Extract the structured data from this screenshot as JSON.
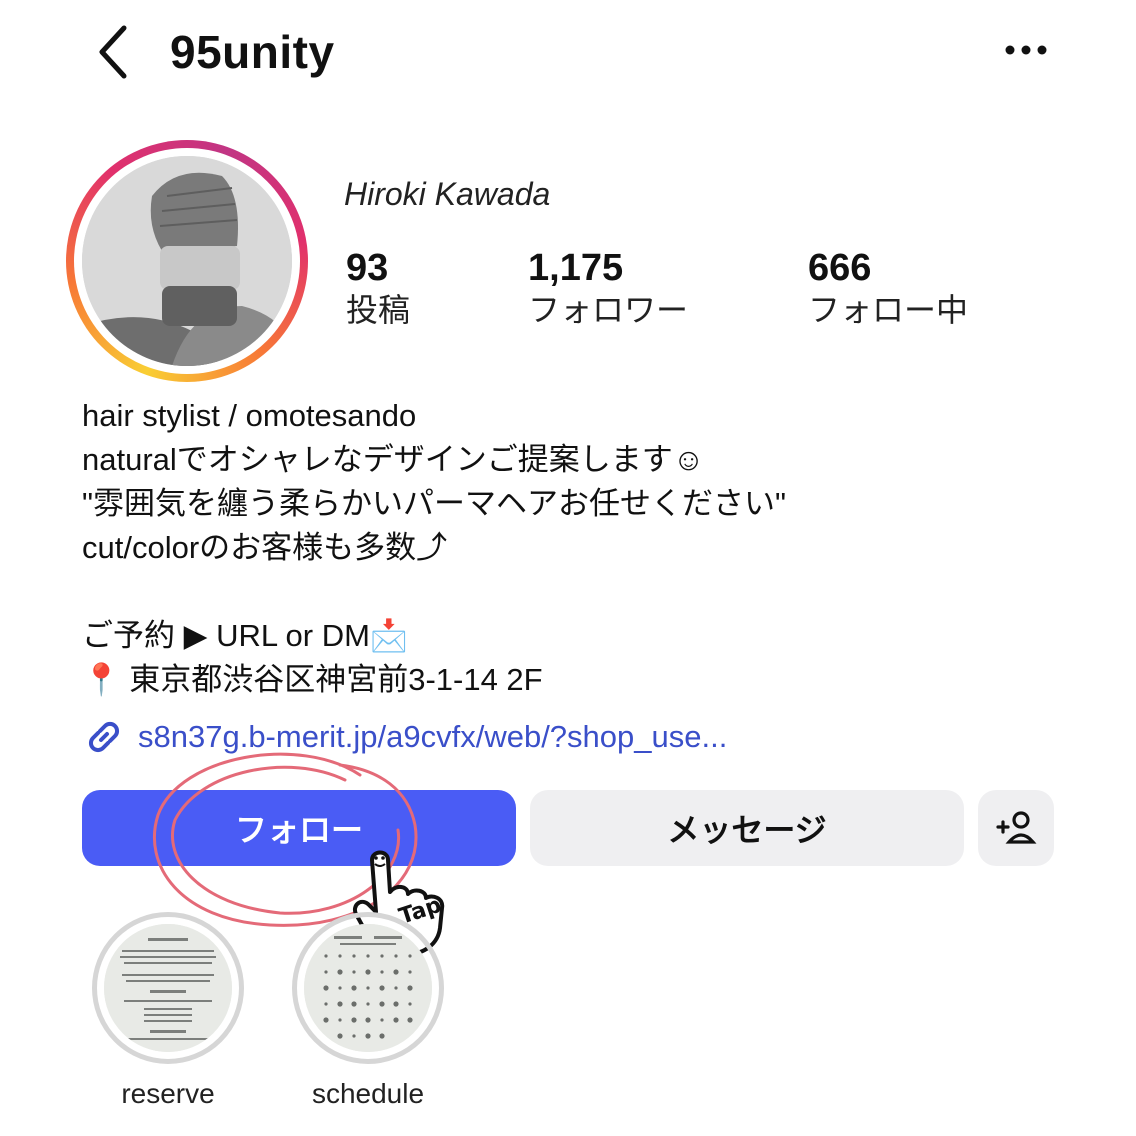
{
  "header": {
    "username": "95unity",
    "back_icon": "chevron-left-icon",
    "more_icon": "ellipsis-icon"
  },
  "profile": {
    "display_name": "Hiroki Kawada",
    "stats": [
      {
        "value": "93",
        "label": "投稿"
      },
      {
        "value": "1,175",
        "label": "フォロワー"
      },
      {
        "value": "666",
        "label": "フォロー中"
      }
    ]
  },
  "bio": {
    "lines": [
      "hair stylist / omotesando",
      "naturalでオシャレなデザインご提案します☺",
      "\"雰囲気を纏う柔らかいパーマヘアお任せください\"",
      "cut/colorのお客様も多数⤴",
      "",
      "ご予約 ▶ URL or DM📩",
      "📍 東京都渋谷区神宮前3-1-14 2F"
    ],
    "link": "s8n37g.b-merit.jp/a9cvfx/web/?shop_use..."
  },
  "actions": {
    "follow_label": "フォロー",
    "message_label": "メッセージ",
    "add_user_icon": "add-person-icon"
  },
  "annotation": {
    "tap_label": "Tap"
  },
  "highlights": [
    {
      "label": "reserve"
    },
    {
      "label": "schedule"
    }
  ],
  "colors": {
    "accent": "#4a5cf5",
    "link": "#3a4fc9",
    "annotation": "#e46a78"
  }
}
